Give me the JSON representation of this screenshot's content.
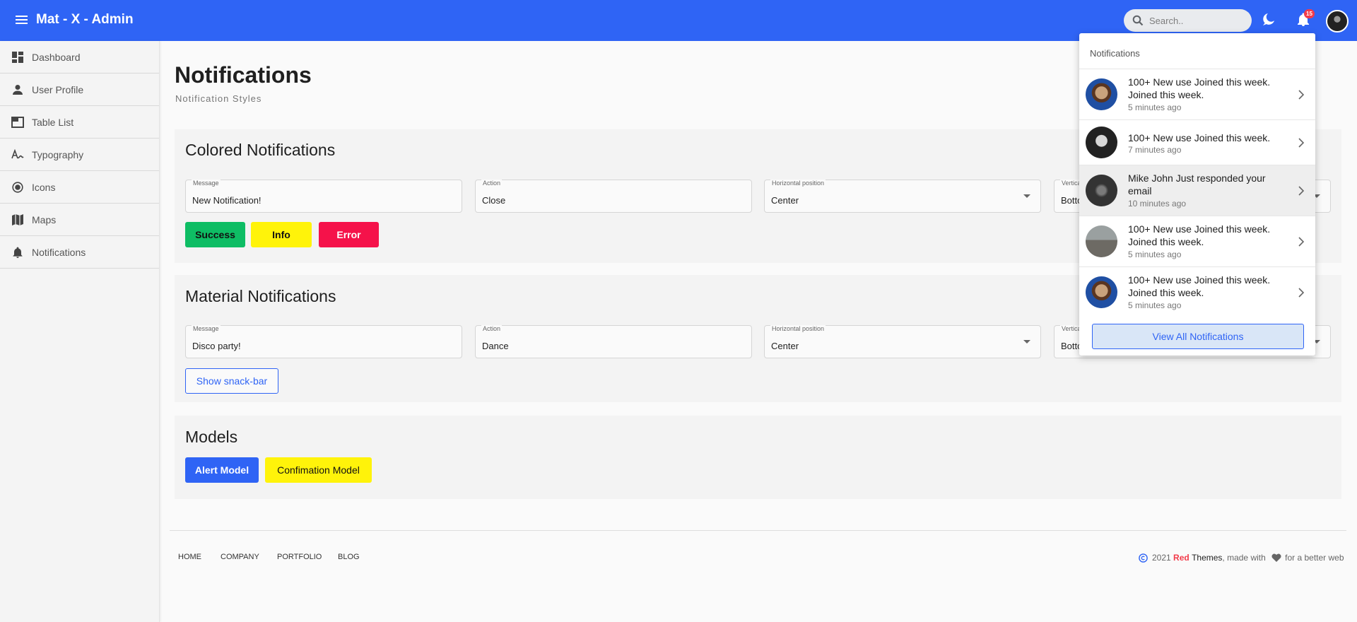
{
  "header": {
    "brand": "Mat - X - Admin",
    "search_placeholder": "Search..",
    "notification_count": "15"
  },
  "sidebar": {
    "items": [
      {
        "label": "Dashboard",
        "icon": "dashboard-icon"
      },
      {
        "label": "User Profile",
        "icon": "person-icon"
      },
      {
        "label": "Table List",
        "icon": "table-icon"
      },
      {
        "label": "Typography",
        "icon": "typography-icon"
      },
      {
        "label": "Icons",
        "icon": "radio-icon"
      },
      {
        "label": "Maps",
        "icon": "map-icon"
      },
      {
        "label": "Notifications",
        "icon": "bell-icon"
      }
    ]
  },
  "page": {
    "title": "Notifications",
    "subtitle": "Notification Styles"
  },
  "colored": {
    "heading": "Colored Notifications",
    "message_label": "Message",
    "message_value": "New Notification!",
    "action_label": "Action",
    "action_value": "Close",
    "hpos_label": "Horizontal position",
    "hpos_value": "Center",
    "vpos_label": "Vertica",
    "vpos_value": "Botto",
    "btn_success": "Success",
    "btn_info": "Info",
    "btn_error": "Error"
  },
  "material": {
    "heading": "Material Notifications",
    "message_label": "Message",
    "message_value": "Disco party!",
    "action_label": "Action",
    "action_value": "Dance",
    "hpos_label": "Horizontal position",
    "hpos_value": "Center",
    "vpos_label": "Vertica",
    "vpos_value": "Botto",
    "btn_snack": "Show snack-bar"
  },
  "models": {
    "heading": "Models",
    "btn_alert": "Alert Model",
    "btn_confirm": "Confimation Model"
  },
  "footer": {
    "links": [
      "HOME",
      "COMPANY",
      "PORTFOLIO",
      "BLOG"
    ],
    "year": "2021",
    "brand_red": "Red",
    "brand_rest": "Themes",
    "made_with": ", made with",
    "tail": "for a better web"
  },
  "notifications_panel": {
    "title": "Notifications",
    "items": [
      {
        "text": "100+ New use Joined this week. Joined this week.",
        "time": "5 minutes ago"
      },
      {
        "text": "100+ New use Joined this week.",
        "time": "7 minutes ago"
      },
      {
        "text": "Mike John Just responded your email",
        "time": "10 minutes ago"
      },
      {
        "text": "100+ New use Joined this week. Joined this week.",
        "time": "5 minutes ago"
      },
      {
        "text": "100+ New use Joined this week. Joined this week.",
        "time": "5 minutes ago"
      }
    ],
    "view_all": "View All Notifications"
  },
  "colors": {
    "primary": "#2f64f5",
    "success": "#0ebd64",
    "info": "#fff30a",
    "error": "#f5124a",
    "badge": "#f23b4a"
  }
}
